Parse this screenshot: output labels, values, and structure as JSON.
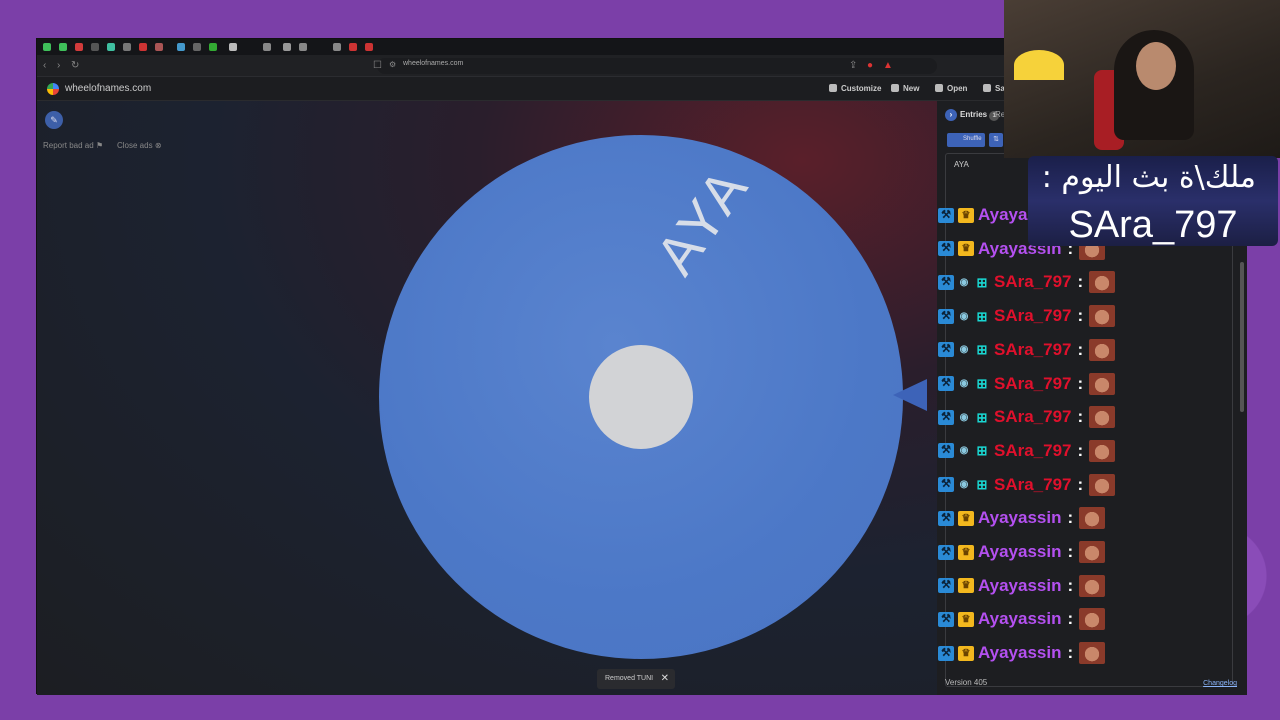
{
  "browser": {
    "url": "wheelofnames.com"
  },
  "app": {
    "site_name": "wheelofnames.com",
    "menu": [
      "Customize",
      "New",
      "Open",
      "Sa"
    ]
  },
  "ads": {
    "report": "Report bad ad",
    "close": "Close ads"
  },
  "wheel": {
    "segment_label": "AYA"
  },
  "toast": {
    "text": "Removed TUNI",
    "close": "✕"
  },
  "panel": {
    "entries_label": "Entries",
    "entries_count": "1",
    "results_label": "Re",
    "shuffle_label": "Shuffle",
    "textarea_value": "AYA",
    "version": "Version 405",
    "changelog": "Changelog"
  },
  "chat": {
    "colors": {
      "purple": "#b450f0",
      "red": "#e0102c"
    },
    "rows": [
      {
        "user": "Ayayassin",
        "type": "crown",
        "color": "#b450f0"
      },
      {
        "user": "Ayayassin",
        "type": "crown",
        "color": "#b450f0"
      },
      {
        "user": "SAra_797",
        "type": "gift",
        "color": "#e0102c"
      },
      {
        "user": "SAra_797",
        "type": "gift",
        "color": "#e0102c"
      },
      {
        "user": "SAra_797",
        "type": "gift",
        "color": "#e0102c"
      },
      {
        "user": "SAra_797",
        "type": "gift",
        "color": "#e0102c"
      },
      {
        "user": "SAra_797",
        "type": "gift",
        "color": "#e0102c"
      },
      {
        "user": "SAra_797",
        "type": "gift",
        "color": "#e0102c"
      },
      {
        "user": "SAra_797",
        "type": "gift",
        "color": "#e0102c"
      },
      {
        "user": "Ayayassin",
        "type": "crown",
        "color": "#b450f0"
      },
      {
        "user": "Ayayassin",
        "type": "crown",
        "color": "#b450f0"
      },
      {
        "user": "Ayayassin",
        "type": "crown",
        "color": "#b450f0"
      },
      {
        "user": "Ayayassin",
        "type": "crown",
        "color": "#b450f0"
      },
      {
        "user": "Ayayassin",
        "type": "crown",
        "color": "#b450f0"
      }
    ]
  },
  "overlay": {
    "title": "ملك\\ة بث اليوم :",
    "name": "SAra_797"
  }
}
